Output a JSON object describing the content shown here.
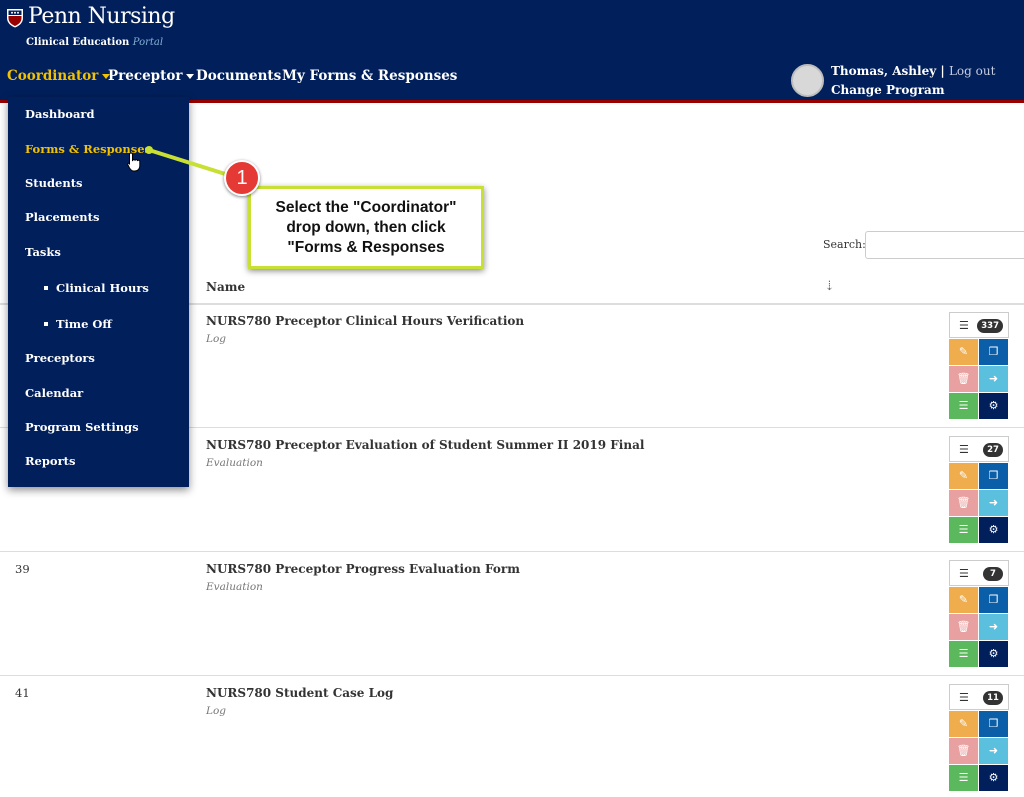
{
  "brand": {
    "title": "Penn Nursing",
    "subtitle": "Clinical Education",
    "subtitle_em": "Portal"
  },
  "nav": {
    "items": [
      {
        "label": "Coordinator",
        "has_caret": true,
        "active": true
      },
      {
        "label": "Preceptor",
        "has_caret": true,
        "active": false
      },
      {
        "label": "Documents",
        "has_caret": false,
        "active": false
      },
      {
        "label": "My Forms & Responses",
        "has_caret": false,
        "active": false
      }
    ]
  },
  "user": {
    "name": "Thomas, Ashley",
    "separator": "|",
    "logout": "Log out",
    "change_program": "Change Program"
  },
  "dropdown": {
    "items": [
      {
        "label": "Dashboard"
      },
      {
        "label": "Forms & Responses",
        "active": true
      },
      {
        "label": "Students"
      },
      {
        "label": "Placements"
      },
      {
        "label": "Tasks"
      },
      {
        "label": "Clinical Hours",
        "sub": true
      },
      {
        "label": "Time Off",
        "sub": true
      },
      {
        "label": "Preceptors"
      },
      {
        "label": "Calendar"
      },
      {
        "label": "Program Settings"
      },
      {
        "label": "Reports"
      }
    ]
  },
  "callout": {
    "number": "1",
    "lines": [
      "Select the \"Coordinator\"",
      "drop down, then click",
      "\"Forms & Responses"
    ]
  },
  "search": {
    "label": "Search:",
    "value": ""
  },
  "table": {
    "header": {
      "name": "Name"
    },
    "rows": [
      {
        "id": "",
        "title": "NURS780 Preceptor Clinical Hours Verification",
        "type": "Log",
        "count": "337"
      },
      {
        "id": "",
        "title": "NURS780 Preceptor Evaluation of Student Summer II 2019 Final",
        "type": "Evaluation",
        "count": "27"
      },
      {
        "id": "39",
        "title": "NURS780 Preceptor Progress Evaluation Form",
        "type": "Evaluation",
        "count": "7"
      },
      {
        "id": "41",
        "title": "NURS780 Student Case Log",
        "type": "Log",
        "count": "11"
      }
    ]
  },
  "colors": {
    "nav_bg": "#011f5b",
    "accent": "#f2c100",
    "header_border": "#990000",
    "callout_border": "#c8e033",
    "callout_badge": "#e53935"
  },
  "icons": {
    "sort": "sort-icon",
    "list": "list-icon",
    "edit": "pencil-icon",
    "copy": "copy-icon",
    "delete": "trash-icon",
    "export": "export-icon",
    "responses": "list-icon",
    "settings": "gear-icon"
  }
}
